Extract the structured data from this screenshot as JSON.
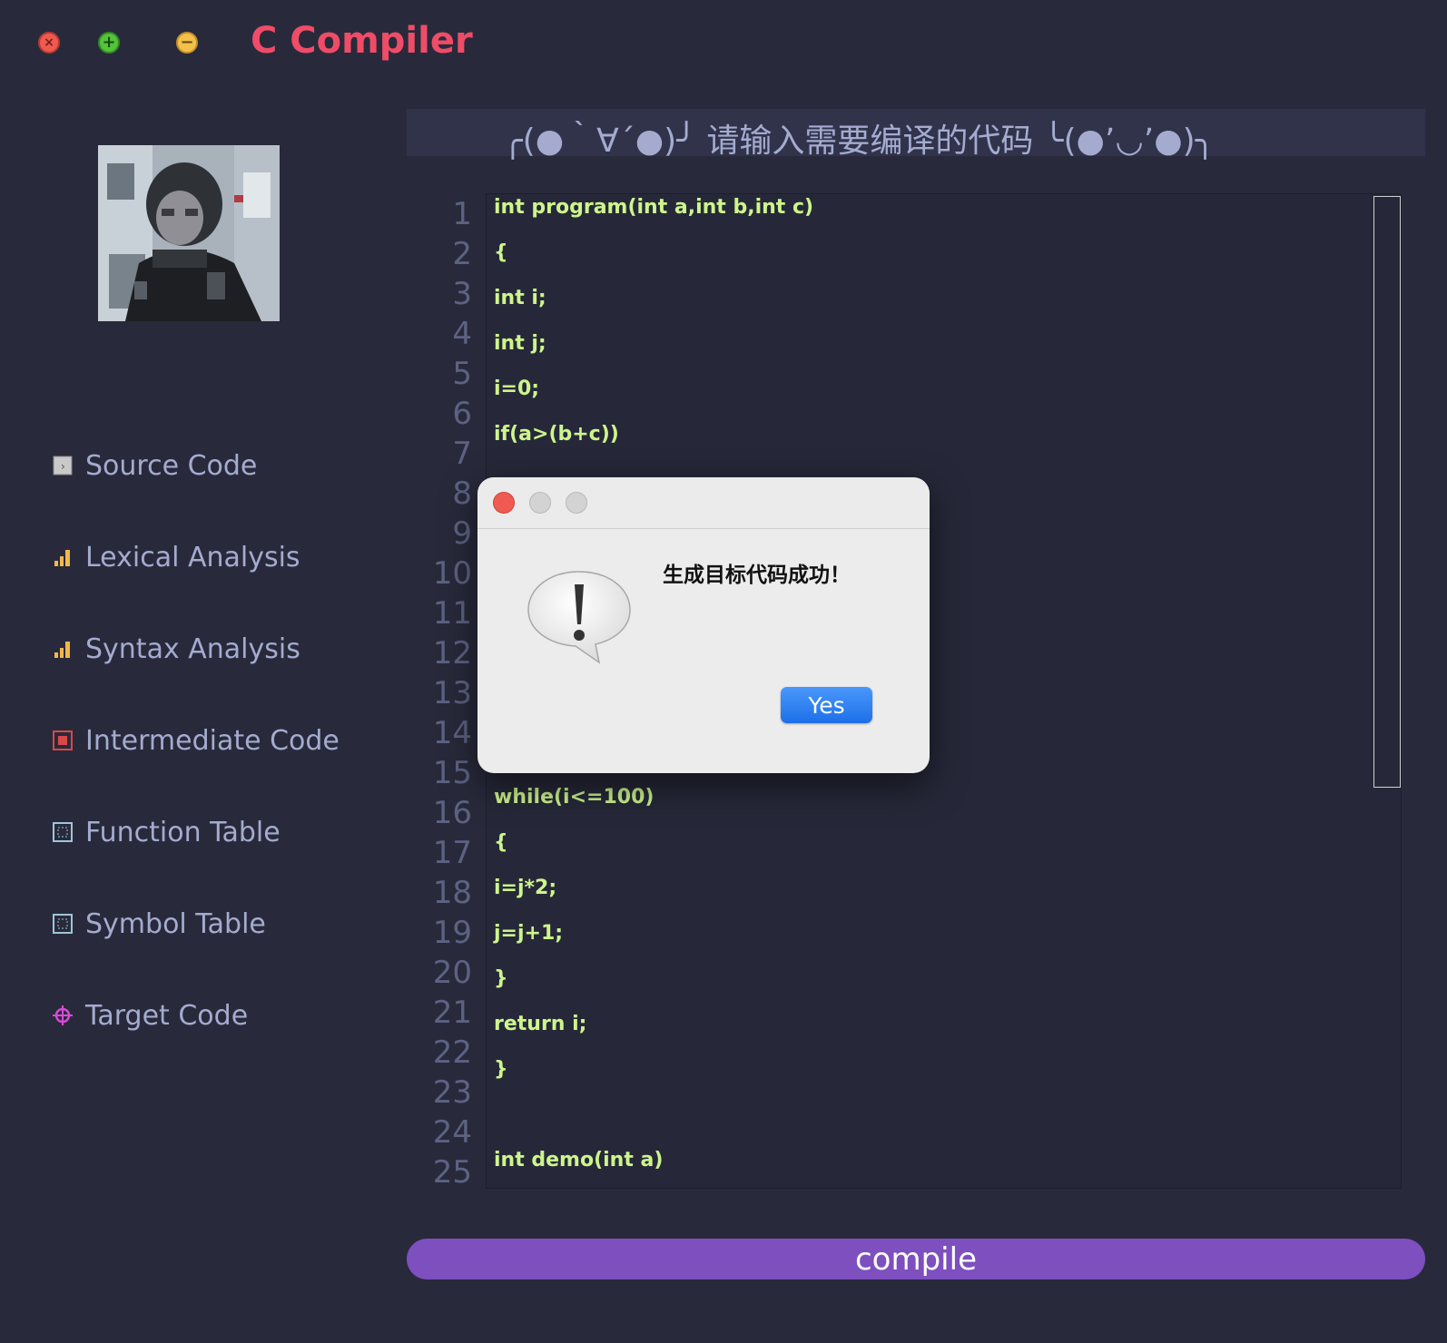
{
  "window": {
    "title": "C Compiler",
    "controls": [
      {
        "name": "close",
        "glyph": "×",
        "color": "#ee5a4f"
      },
      {
        "name": "maximize",
        "glyph": "+",
        "color": "#55c33b"
      },
      {
        "name": "minimize",
        "glyph": "−",
        "color": "#f3c04b"
      }
    ]
  },
  "sidebar": {
    "items": [
      {
        "label": "Source Code",
        "icon": "source-file-icon",
        "icon_color": "#c9c9c9"
      },
      {
        "label": "Lexical Analysis",
        "icon": "bar-chart-icon",
        "icon_color": "#f2b84b"
      },
      {
        "label": "Syntax Analysis",
        "icon": "bar-chart-icon",
        "icon_color": "#f2b84b"
      },
      {
        "label": "Intermediate Code",
        "icon": "box-icon",
        "icon_color": "#d94848"
      },
      {
        "label": "Function Table",
        "icon": "table-icon",
        "icon_color": "#9ec6d8"
      },
      {
        "label": "Symbol Table",
        "icon": "table-icon",
        "icon_color": "#9ec6d8"
      },
      {
        "label": "Target Code",
        "icon": "target-icon",
        "icon_color": "#d84bd8"
      }
    ]
  },
  "banner": {
    "text": "╭(●｀∀´●)╯  请输入需要编译的代码  ╰(●’◡’●)╮"
  },
  "editor": {
    "line_numbers": [
      "1",
      "2",
      "3",
      "4",
      "5",
      "6",
      "7",
      "8",
      "9",
      "10",
      "11",
      "12",
      "13",
      "14",
      "15",
      "16",
      "17",
      "18",
      "19",
      "20",
      "21",
      "22",
      "23",
      "24",
      "25"
    ],
    "lines": [
      "int program(int a,int b,int c)",
      "{",
      "int i;",
      "int j;",
      "i=0;",
      "if(a>(b+c))",
      "",
      "",
      "",
      "",
      "",
      "",
      "",
      "while(i<=100)",
      "{",
      "i=j*2;",
      "j=j+1;",
      "}",
      "return i;",
      "}",
      "",
      "int demo(int a)"
    ],
    "code_color": "#cdf58c"
  },
  "compile_button": {
    "label": "compile",
    "color": "#7e4fbf"
  },
  "dialog": {
    "message": "生成目标代码成功！",
    "yes_label": "Yes",
    "icon": "alert-speech-bubble-icon"
  }
}
